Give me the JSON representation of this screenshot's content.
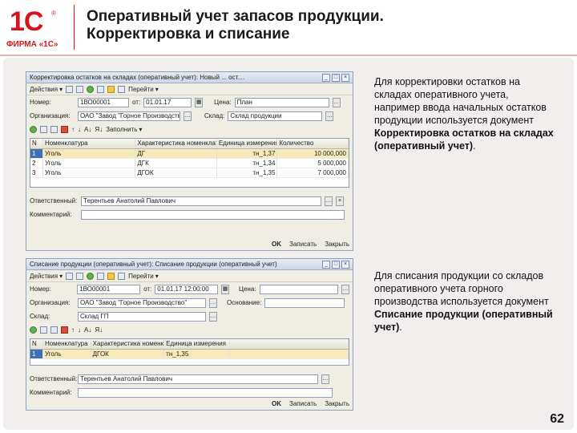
{
  "brand": {
    "logo_text": "1С",
    "registered": "®",
    "firm_text": "ФИРМА «1С»",
    "accent_color": "#d4151b"
  },
  "slide": {
    "title_line1": "Оперативный учет запасов продукции.",
    "title_line2": "Корректировка и списание",
    "page_number": "62"
  },
  "window1": {
    "title": "Корректировка остатков на складах (оперативный учет): Новый ... ост....",
    "toolbar": {
      "action": "Действия",
      "goto": "Перейти"
    },
    "fields": {
      "number_label": "Номер:",
      "number_value": "1ВО00001",
      "date_label": "от:",
      "date_value": "01.01.17",
      "price_type_label": "Цена:",
      "price_type_value": "План",
      "org_label": "Организация:",
      "org_value": "ОАО \"Завод \"Горное Производство\"",
      "warehouse_label": "Склад:",
      "warehouse_value": "Склад продукции"
    },
    "grid_toolbar": {
      "fill": "Заполнить"
    },
    "columns": [
      "N",
      "Номенклатура",
      "Характеристика номенклатуры",
      "Единица измерения",
      "Количество"
    ],
    "rows": [
      {
        "n": "1",
        "item": "Уголь",
        "char": "ДГ",
        "unit": "тн_1,37",
        "qty": "10 000,000"
      },
      {
        "n": "2",
        "item": "Уголь",
        "char": "ДГК",
        "unit": "тн_1,34",
        "qty": "5 000,000"
      },
      {
        "n": "3",
        "item": "Уголь",
        "char": "ДГОК",
        "unit": "тн_1,35",
        "qty": "7 000,000"
      }
    ],
    "responsible_label": "Ответственный:",
    "responsible_value": "Терентьев Анатолий Павлович",
    "comment_label": "Комментарий:",
    "footer": {
      "ok": "OK",
      "save": "Записать",
      "close": "Закрыть"
    }
  },
  "window2": {
    "title": "Списание продукции (оперативный учет): Списание продукции (оперативный учет)",
    "toolbar": {
      "action": "Действия",
      "goto": "Перейти"
    },
    "fields": {
      "number_label": "Номер:",
      "number_value": "1ВО00001",
      "date_label": "от:",
      "date_value": "01.01.17 12:00:00",
      "price_label": "Цена:",
      "org_label": "Организация:",
      "org_value": "ОАО \"Завод \"Горное Производство\"",
      "reason_label": "Основание:",
      "warehouse_label": "Склад:",
      "warehouse_value": "Склад ГП"
    },
    "columns": [
      "N",
      "Номенклатура",
      "Характеристика номенклатуры",
      "Единица измерения",
      ""
    ],
    "rows": [
      {
        "n": "1",
        "item": "Уголь",
        "char": "ДГОК",
        "unit": "тн_1,35",
        "qty": ""
      }
    ],
    "responsible_label": "Ответственный:",
    "responsible_value": "Терентьев Анатолий Павлович",
    "comment_label": "Комментарий:",
    "footer": {
      "ok": "OK",
      "save": "Записать",
      "close": "Закрыть"
    }
  },
  "description1": {
    "text": "Для корректировки остатков на складах оперативного учета, например ввода начальных остатков продукции используется документ ",
    "bold": "Корректировка остатков на складах (оперативный учет)",
    "end": "."
  },
  "description2": {
    "text": "Для списания продукции со складов оперативного учета горного производства используется документ ",
    "bold": "Списание продукции (оперативный учет)",
    "end": "."
  }
}
